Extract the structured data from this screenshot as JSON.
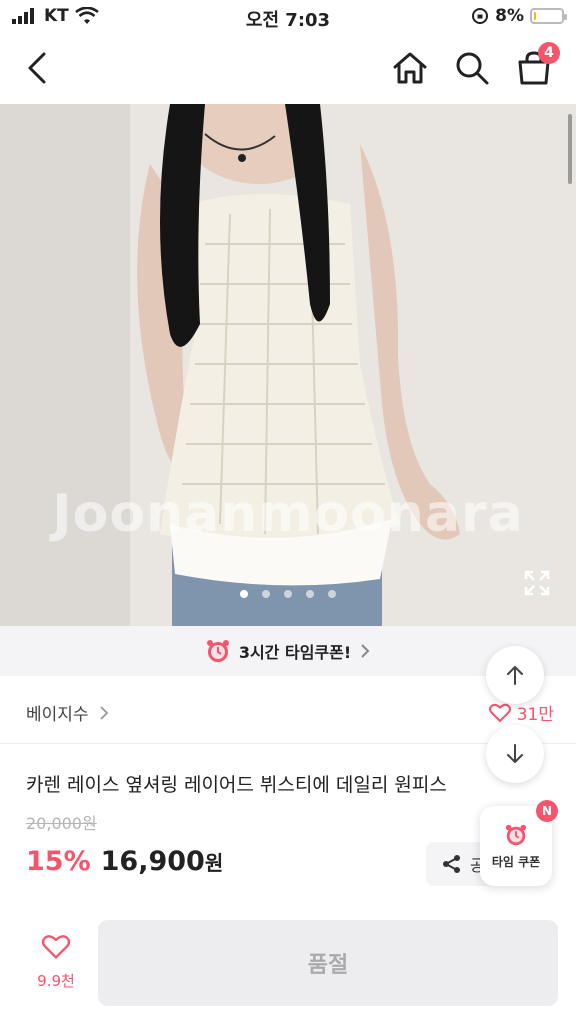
{
  "status_bar": {
    "carrier": "KT",
    "time": "오전 7:03",
    "battery": "8%",
    "battery_level": 0.08
  },
  "nav": {
    "cart_count": "4",
    "icons": [
      "back-icon",
      "home-icon",
      "search-icon",
      "cart-icon"
    ]
  },
  "product_image": {
    "watermark": "Joonanmoonara",
    "slide_count": 5,
    "active_slide": 0
  },
  "coupon_strip": {
    "label": "3시간 타임쿠폰!"
  },
  "store": {
    "name": "베이지수",
    "likes": "31만"
  },
  "product": {
    "title": "카렌 레이스 옆셔링 레이어드 뷔스티에 데일리 원피스",
    "original_price": "20,000원",
    "discount": "15%",
    "price": "16,900",
    "currency": "원"
  },
  "share": {
    "label": "공유"
  },
  "floating": {
    "time_coupon_label": "타임 쿠폰",
    "time_coupon_badge": "N"
  },
  "bottom": {
    "wish_count": "9.9천",
    "soldout_label": "품절"
  },
  "colors": {
    "accent": "#f5546d",
    "muted": "#ededef"
  }
}
